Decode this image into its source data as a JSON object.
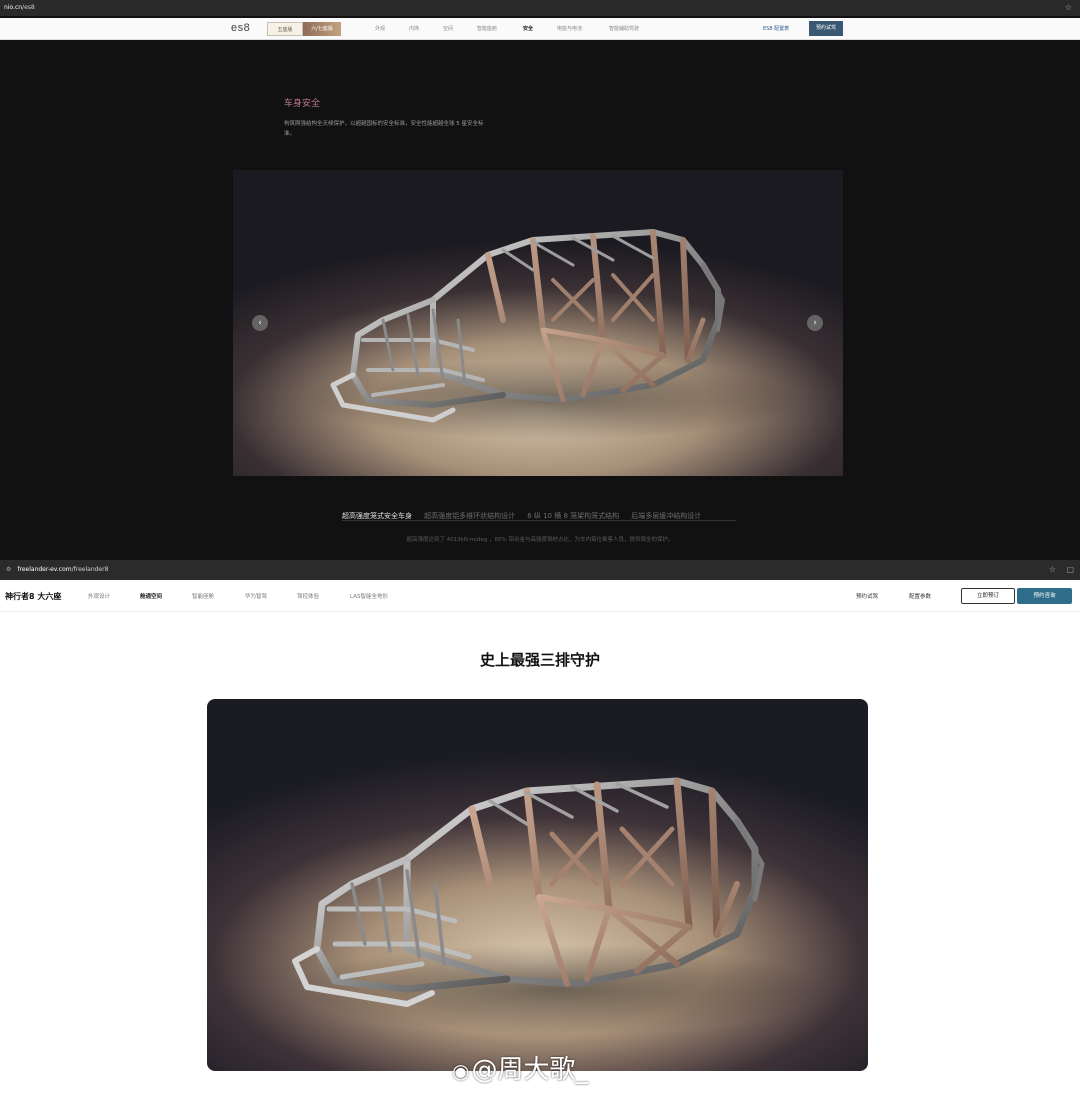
{
  "top": {
    "url_host": "nio.cn",
    "url_path": "/es8",
    "nav": {
      "logo": "es8",
      "pill_a": "五座版",
      "pill_b": "六/七座版",
      "links": [
        "外观",
        "内饰",
        "空间",
        "智能座舱",
        "安全",
        "电能与电池",
        "智能辅助驾驶"
      ],
      "config": "ES8 配置表",
      "cta": "预约试驾"
    },
    "section_title": "车身安全",
    "section_desc": "构筑刚强结构全天候保护，以超越国标的安全标准，安全性能超越全球 5 星安全标准。",
    "tabs": [
      "超高强度笼式安全车身",
      "超高强度铝多维环状结构设计",
      "6 纵 10 横 8 笼架构笼式结构",
      "后端多层缓冲结构设计"
    ],
    "caption": "超高强度达到了 4013kN·m/deg ，80% 铝合金与高强度钢材占比，为车内每位乘客人员，提供周全的保护。"
  },
  "bottom": {
    "url_host": "freelander-ev.com",
    "url_path": "/freelander8",
    "brand": "神行者8 大六座",
    "links": [
      "外观设计",
      "舱通空间",
      "智能座舱",
      "华为智驾",
      "驾控体验",
      "LAS智能全地形"
    ],
    "right_links": [
      "预约试驾",
      "配置参数"
    ],
    "btn_outline": "立即预订",
    "btn_solid": "预约咨询",
    "heading": "史上最强三排守护"
  },
  "watermark": "@周大歌_",
  "icons": {
    "star": "star-icon",
    "arrow_left": "arrow-left-icon",
    "arrow_right": "arrow-right-icon",
    "weibo": "weibo-logo"
  }
}
